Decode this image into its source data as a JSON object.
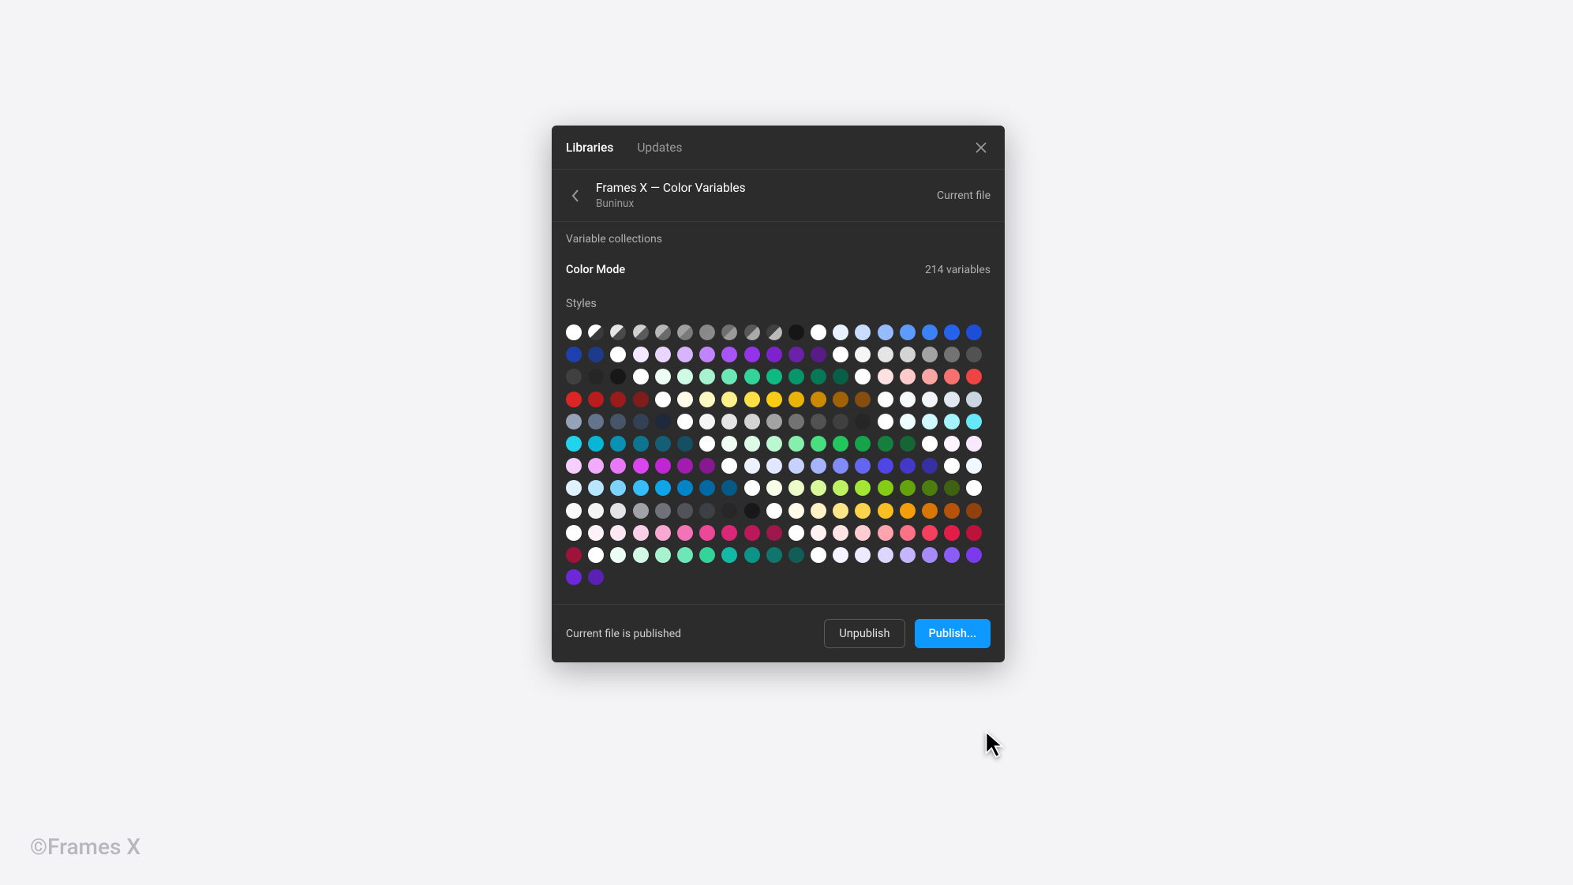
{
  "watermark": "©Frames X",
  "tabs": {
    "libraries": "Libraries",
    "updates": "Updates"
  },
  "header": {
    "title": "Frames X — Color Variables",
    "subtitle": "Buninux",
    "current_file_label": "Current file"
  },
  "sections": {
    "variable_collections_label": "Variable collections",
    "collection_name": "Color Mode",
    "collection_count": "214 variables",
    "styles_label": "Styles"
  },
  "footer": {
    "status": "Current file is published",
    "unpublish": "Unpublish",
    "publish": "Publish..."
  },
  "swatches": [
    [
      "plain",
      "#ffffff",
      true
    ],
    [
      "half",
      "#ffffff",
      "#3a3a3a"
    ],
    [
      "half",
      "#e5e5e5",
      "#4a4a4a"
    ],
    [
      "half",
      "#d0d0d0",
      "#5a5a5a"
    ],
    [
      "half",
      "#b8b8b8",
      "#6a6a6a"
    ],
    [
      "half",
      "#a0a0a0",
      "#7a7a7a"
    ],
    [
      "half",
      "#888888",
      "#8a8a8a"
    ],
    [
      "half",
      "#707070",
      "#9a9a9a"
    ],
    [
      "half",
      "#585858",
      "#aaaaaa"
    ],
    [
      "half",
      "#404040",
      "#bababa"
    ],
    [
      "plain",
      "#161616",
      false
    ],
    [
      "plain",
      "#ffffff",
      true
    ],
    [
      "plain",
      "#e8f1ff",
      false
    ],
    [
      "plain",
      "#c8ddff",
      false
    ],
    [
      "plain",
      "#94bcff",
      false
    ],
    [
      "plain",
      "#5e9bff",
      false
    ],
    [
      "plain",
      "#3b82f6",
      false
    ],
    [
      "plain",
      "#2563eb",
      false
    ],
    [
      "plain",
      "#1d4ed8",
      false
    ],
    [
      "plain",
      "#1e40af",
      false
    ],
    [
      "plain",
      "#1e3a8a",
      false
    ],
    [
      "plain",
      "#ffffff",
      true
    ],
    [
      "plain",
      "#f3e8ff",
      false
    ],
    [
      "plain",
      "#e9d5ff",
      false
    ],
    [
      "plain",
      "#d8b4fe",
      false
    ],
    [
      "plain",
      "#c084fc",
      false
    ],
    [
      "plain",
      "#a855f7",
      false
    ],
    [
      "plain",
      "#9333ea",
      false
    ],
    [
      "plain",
      "#7e22ce",
      false
    ],
    [
      "plain",
      "#6b21a8",
      false
    ],
    [
      "plain",
      "#581c87",
      false
    ],
    [
      "plain",
      "#ffffff",
      true
    ],
    [
      "plain",
      "#f5f5f5",
      false
    ],
    [
      "plain",
      "#e5e5e5",
      false
    ],
    [
      "plain",
      "#d4d4d4",
      false
    ],
    [
      "plain",
      "#a3a3a3",
      false
    ],
    [
      "plain",
      "#737373",
      false
    ],
    [
      "plain",
      "#525252",
      false
    ],
    [
      "plain",
      "#404040",
      false
    ],
    [
      "plain",
      "#262626",
      false
    ],
    [
      "plain",
      "#171717",
      false
    ],
    [
      "plain",
      "#ffffff",
      true
    ],
    [
      "plain",
      "#ecfdf5",
      false
    ],
    [
      "plain",
      "#d1fae5",
      false
    ],
    [
      "plain",
      "#a7f3d0",
      false
    ],
    [
      "plain",
      "#6ee7b7",
      false
    ],
    [
      "plain",
      "#34d399",
      false
    ],
    [
      "plain",
      "#10b981",
      false
    ],
    [
      "plain",
      "#059669",
      false
    ],
    [
      "plain",
      "#047857",
      false
    ],
    [
      "plain",
      "#065f46",
      false
    ],
    [
      "plain",
      "#ffffff",
      true
    ],
    [
      "plain",
      "#fee2e2",
      false
    ],
    [
      "plain",
      "#fecaca",
      false
    ],
    [
      "plain",
      "#fca5a5",
      false
    ],
    [
      "plain",
      "#f87171",
      false
    ],
    [
      "plain",
      "#ef4444",
      false
    ],
    [
      "plain",
      "#dc2626",
      false
    ],
    [
      "plain",
      "#b91c1c",
      false
    ],
    [
      "plain",
      "#991b1b",
      false
    ],
    [
      "plain",
      "#7f1d1d",
      false
    ],
    [
      "plain",
      "#ffffff",
      true
    ],
    [
      "plain",
      "#fefce8",
      false
    ],
    [
      "plain",
      "#fef9c3",
      false
    ],
    [
      "plain",
      "#fef08a",
      false
    ],
    [
      "plain",
      "#fde047",
      false
    ],
    [
      "plain",
      "#facc15",
      false
    ],
    [
      "plain",
      "#eab308",
      false
    ],
    [
      "plain",
      "#ca8a04",
      false
    ],
    [
      "plain",
      "#a16207",
      false
    ],
    [
      "plain",
      "#854d0e",
      false
    ],
    [
      "plain",
      "#ffffff",
      true
    ],
    [
      "plain",
      "#f8fafc",
      false
    ],
    [
      "plain",
      "#f1f5f9",
      false
    ],
    [
      "plain",
      "#e2e8f0",
      false
    ],
    [
      "plain",
      "#cbd5e1",
      false
    ],
    [
      "plain",
      "#94a3b8",
      false
    ],
    [
      "plain",
      "#64748b",
      false
    ],
    [
      "plain",
      "#475569",
      false
    ],
    [
      "plain",
      "#334155",
      false
    ],
    [
      "plain",
      "#1e293b",
      false
    ],
    [
      "plain",
      "#ffffff",
      true
    ],
    [
      "plain",
      "#f5f5f5",
      false
    ],
    [
      "plain",
      "#e5e5e5",
      false
    ],
    [
      "plain",
      "#d4d4d4",
      false
    ],
    [
      "plain",
      "#a3a3a3",
      false
    ],
    [
      "plain",
      "#737373",
      false
    ],
    [
      "plain",
      "#525252",
      false
    ],
    [
      "plain",
      "#404040",
      false
    ],
    [
      "plain",
      "#262626",
      false
    ],
    [
      "plain",
      "#ffffff",
      true
    ],
    [
      "plain",
      "#ecfeff",
      false
    ],
    [
      "plain",
      "#cffafe",
      false
    ],
    [
      "plain",
      "#a5f3fc",
      false
    ],
    [
      "plain",
      "#67e8f9",
      false
    ],
    [
      "plain",
      "#22d3ee",
      false
    ],
    [
      "plain",
      "#06b6d4",
      false
    ],
    [
      "plain",
      "#0891b2",
      false
    ],
    [
      "plain",
      "#0e7490",
      false
    ],
    [
      "plain",
      "#155e75",
      false
    ],
    [
      "plain",
      "#164e63",
      false
    ],
    [
      "plain",
      "#ffffff",
      true
    ],
    [
      "plain",
      "#f0fdf4",
      false
    ],
    [
      "plain",
      "#dcfce7",
      false
    ],
    [
      "plain",
      "#bbf7d0",
      false
    ],
    [
      "plain",
      "#86efac",
      false
    ],
    [
      "plain",
      "#4ade80",
      false
    ],
    [
      "plain",
      "#22c55e",
      false
    ],
    [
      "plain",
      "#16a34a",
      false
    ],
    [
      "plain",
      "#15803d",
      false
    ],
    [
      "plain",
      "#166534",
      false
    ],
    [
      "plain",
      "#ffffff",
      true
    ],
    [
      "plain",
      "#fdf4ff",
      false
    ],
    [
      "plain",
      "#fae8ff",
      false
    ],
    [
      "plain",
      "#f5d0fe",
      false
    ],
    [
      "plain",
      "#f0abfc",
      false
    ],
    [
      "plain",
      "#e879f9",
      false
    ],
    [
      "plain",
      "#d946ef",
      false
    ],
    [
      "plain",
      "#c026d3",
      false
    ],
    [
      "plain",
      "#a21caf",
      false
    ],
    [
      "plain",
      "#86198f",
      false
    ],
    [
      "plain",
      "#ffffff",
      true
    ],
    [
      "plain",
      "#eef2ff",
      false
    ],
    [
      "plain",
      "#e0e7ff",
      false
    ],
    [
      "plain",
      "#c7d2fe",
      false
    ],
    [
      "plain",
      "#a5b4fc",
      false
    ],
    [
      "plain",
      "#818cf8",
      false
    ],
    [
      "plain",
      "#6366f1",
      false
    ],
    [
      "plain",
      "#4f46e5",
      false
    ],
    [
      "plain",
      "#4338ca",
      false
    ],
    [
      "plain",
      "#3730a3",
      false
    ],
    [
      "plain",
      "#ffffff",
      true
    ],
    [
      "plain",
      "#f0f9ff",
      false
    ],
    [
      "plain",
      "#e0f2fe",
      false
    ],
    [
      "plain",
      "#bae6fd",
      false
    ],
    [
      "plain",
      "#7dd3fc",
      false
    ],
    [
      "plain",
      "#38bdf8",
      false
    ],
    [
      "plain",
      "#0ea5e9",
      false
    ],
    [
      "plain",
      "#0284c7",
      false
    ],
    [
      "plain",
      "#0369a1",
      false
    ],
    [
      "plain",
      "#075985",
      false
    ],
    [
      "plain",
      "#ffffff",
      true
    ],
    [
      "plain",
      "#f7fee7",
      false
    ],
    [
      "plain",
      "#ecfccb",
      false
    ],
    [
      "plain",
      "#d9f99d",
      false
    ],
    [
      "plain",
      "#bef264",
      false
    ],
    [
      "plain",
      "#a3e635",
      false
    ],
    [
      "plain",
      "#84cc16",
      false
    ],
    [
      "plain",
      "#65a30d",
      false
    ],
    [
      "plain",
      "#4d7c0f",
      false
    ],
    [
      "plain",
      "#3f6212",
      false
    ],
    [
      "plain",
      "#ffffff",
      true
    ],
    [
      "plain",
      "#fafafa",
      false
    ],
    [
      "plain",
      "#f4f4f5",
      false
    ],
    [
      "plain",
      "#e4e4e7",
      false
    ],
    [
      "plain",
      "#a1a1aa",
      false
    ],
    [
      "plain",
      "#71717a",
      false
    ],
    [
      "plain",
      "#52525b",
      false
    ],
    [
      "plain",
      "#3f3f46",
      false
    ],
    [
      "plain",
      "#27272a",
      false
    ],
    [
      "plain",
      "#18181b",
      false
    ],
    [
      "plain",
      "#ffffff",
      true
    ],
    [
      "plain",
      "#fffbeb",
      false
    ],
    [
      "plain",
      "#fef3c7",
      false
    ],
    [
      "plain",
      "#fde68a",
      false
    ],
    [
      "plain",
      "#fcd34d",
      false
    ],
    [
      "plain",
      "#fbbf24",
      false
    ],
    [
      "plain",
      "#f59e0b",
      false
    ],
    [
      "plain",
      "#d97706",
      false
    ],
    [
      "plain",
      "#b45309",
      false
    ],
    [
      "plain",
      "#92400e",
      false
    ],
    [
      "plain",
      "#ffffff",
      true
    ],
    [
      "plain",
      "#fdf2f8",
      false
    ],
    [
      "plain",
      "#fce7f3",
      false
    ],
    [
      "plain",
      "#fbcfe8",
      false
    ],
    [
      "plain",
      "#f9a8d4",
      false
    ],
    [
      "plain",
      "#f472b6",
      false
    ],
    [
      "plain",
      "#ec4899",
      false
    ],
    [
      "plain",
      "#db2777",
      false
    ],
    [
      "plain",
      "#be185d",
      false
    ],
    [
      "plain",
      "#9d174d",
      false
    ],
    [
      "plain",
      "#ffffff",
      true
    ],
    [
      "plain",
      "#fff1f2",
      false
    ],
    [
      "plain",
      "#ffe4e6",
      false
    ],
    [
      "plain",
      "#fecdd3",
      false
    ],
    [
      "plain",
      "#fda4af",
      false
    ],
    [
      "plain",
      "#fb7185",
      false
    ],
    [
      "plain",
      "#f43f5e",
      false
    ],
    [
      "plain",
      "#e11d48",
      false
    ],
    [
      "plain",
      "#be123c",
      false
    ],
    [
      "plain",
      "#9f1239",
      false
    ],
    [
      "plain",
      "#ffffff",
      true
    ],
    [
      "plain",
      "#ecfdf5",
      false
    ],
    [
      "plain",
      "#d1fae5",
      false
    ],
    [
      "plain",
      "#a7f3d0",
      false
    ],
    [
      "plain",
      "#6ee7b7",
      false
    ],
    [
      "plain",
      "#34d399",
      false
    ],
    [
      "plain",
      "#14b8a6",
      false
    ],
    [
      "plain",
      "#0d9488",
      false
    ],
    [
      "plain",
      "#0f766e",
      false
    ],
    [
      "plain",
      "#115e59",
      false
    ],
    [
      "plain",
      "#ffffff",
      true
    ],
    [
      "plain",
      "#f5f3ff",
      false
    ],
    [
      "plain",
      "#ede9fe",
      false
    ],
    [
      "plain",
      "#ddd6fe",
      false
    ],
    [
      "plain",
      "#c4b5fd",
      false
    ],
    [
      "plain",
      "#a78bfa",
      false
    ],
    [
      "plain",
      "#8b5cf6",
      false
    ],
    [
      "plain",
      "#7c3aed",
      false
    ],
    [
      "plain",
      "#6d28d9",
      false
    ],
    [
      "plain",
      "#5b21b6",
      false
    ]
  ]
}
